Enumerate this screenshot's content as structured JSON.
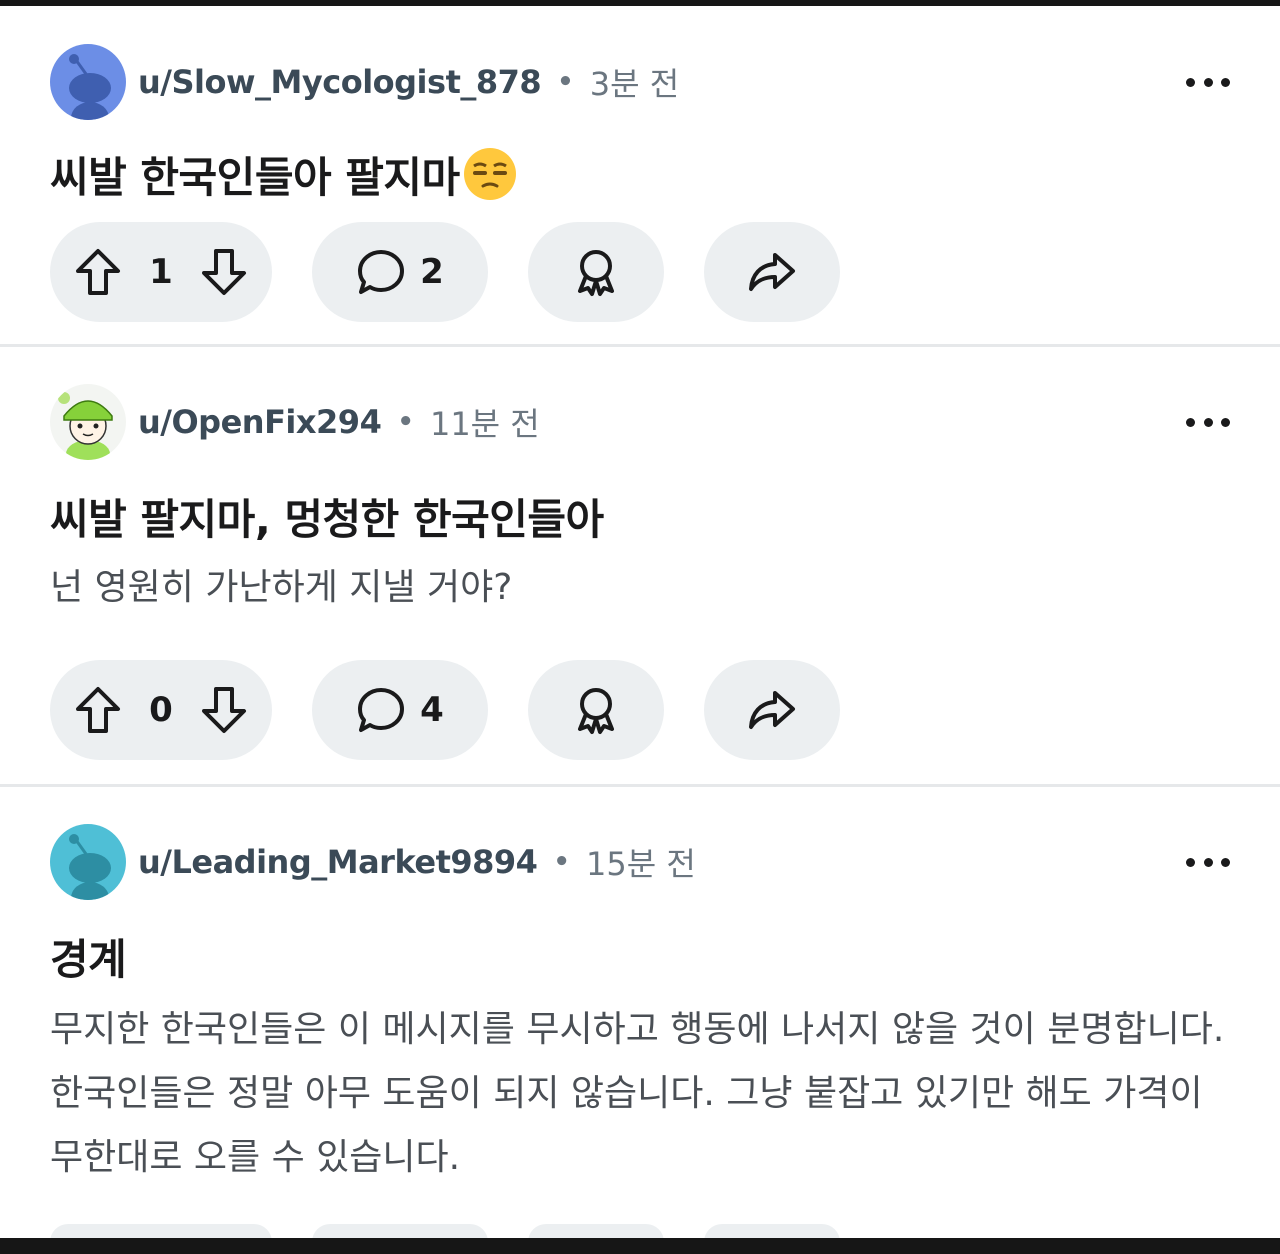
{
  "posts": [
    {
      "username": "u/Slow_Mycologist_878",
      "separator_dot": "•",
      "time": "3분 전",
      "title": "씨발 한국인들아 팔지마",
      "title_emoji": "unamused-face-emoji",
      "body": "",
      "votes": "1",
      "comments": "2",
      "avatar_color": "#6c8ee6"
    },
    {
      "username": "u/OpenFix294",
      "separator_dot": "•",
      "time": "11분 전",
      "title": "씨발 팔지마, 멍청한 한국인들아",
      "body": "넌 영원히 가난하게 지낼 거야?",
      "votes": "0",
      "comments": "4",
      "avatar_color": "#86d13a"
    },
    {
      "username": "u/Leading_Market9894",
      "separator_dot": "•",
      "time": "15분 전",
      "title": "경계",
      "body": "무지한 한국인들은 이 메시지를 무시하고 행동에 나서지 않을 것이 분명합니다. 한국인들은 정말 아무 도움이 되지 않습니다. 그냥 붙잡고 있기만 해도 가격이 무한대로 오를 수 있습니다.",
      "avatar_color": "#4fbfd6"
    }
  ],
  "icons": {
    "upvote": "arrow-up-outline-icon",
    "downvote": "arrow-down-outline-icon",
    "comment": "speech-bubble-icon",
    "award": "award-ribbon-icon",
    "share": "share-arrow-icon",
    "more": "ellipsis-horizontal-icon"
  },
  "colors": {
    "background": "#ffffff",
    "pill": "#eceff1",
    "username": "#3b4a57",
    "meta": "#6b7680",
    "body_text": "#4a4f55"
  }
}
